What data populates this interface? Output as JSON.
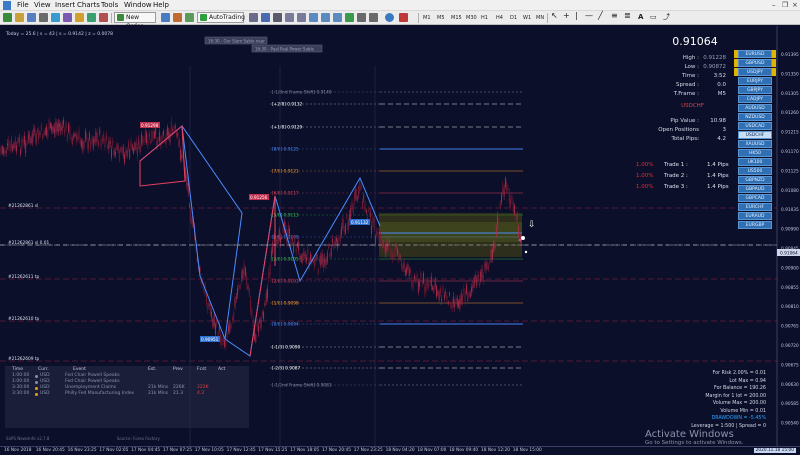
{
  "menu": {
    "items": [
      "File",
      "View",
      "Insert",
      "Charts",
      "Tools",
      "Window",
      "Help"
    ]
  },
  "toolbar": {
    "new_order": "New Order",
    "autotrading": "AutoTrading",
    "timeframes": [
      "M1",
      "M5",
      "M15",
      "M30",
      "H1",
      "H4",
      "D1",
      "W1",
      "MN"
    ]
  },
  "ohlc_line": "Today = 25.6 | s = 43 | s = 0.9142 | z = 0.0078",
  "chart_labels": {
    "top_box_1": "16:30 - Our Slam Sable near",
    "top_box_2": "16:30 - Paal Paal Power Sable",
    "levels": [
      {
        "label": "[-1/8nd Frame Shift] 0.9140",
        "color": "#8a8fa8"
      },
      {
        "label": "[+2/8] 0.9132",
        "color": "#ffffff"
      },
      {
        "label": "[+1/8] 0.9129",
        "color": "#ffffff"
      },
      {
        "label": "[8/8] 0.9125",
        "color": "#4a8cff"
      },
      {
        "label": "[7/8] 0.9121",
        "color": "#ff9a2a"
      },
      {
        "label": "[6/8] 0.9117",
        "color": "#e84060"
      },
      {
        "label": "[5/8] 0.9113",
        "color": "#36c84a"
      },
      {
        "label": "[4/8] 0.9109",
        "color": "#4a8cff"
      },
      {
        "label": "[3/8] 0.9105",
        "color": "#36c84a"
      },
      {
        "label": "[2/8] 0.9101",
        "color": "#e84060"
      },
      {
        "label": "[1/8] 0.9098",
        "color": "#ff9a2a"
      },
      {
        "label": "[0/8] 0.9094",
        "color": "#4a8cff"
      },
      {
        "label": "[-1/8] 0.9090",
        "color": "#ffffff"
      },
      {
        "label": "[-2/8] 0.9087",
        "color": "#ffffff"
      },
      {
        "label": "[-1/2nd Frame Shift] 0.9083",
        "color": "#8a8fa8"
      }
    ],
    "left_tags": [
      "#21262861 sl",
      "#21262861 sl 0.01",
      "#21262611 tp",
      "#21262610 tp",
      "#21262609 tp"
    ],
    "zz_high": "0.91298",
    "zz_mid": "0.91256",
    "zz_low": "0.90951",
    "zz_right": "0.91132"
  },
  "price_axis": [
    "0.91395",
    "0.91350",
    "0.91305",
    "0.91260",
    "0.91215",
    "0.91170",
    "0.91125",
    "0.91080",
    "0.91035",
    "0.90990",
    "0.90945",
    "0.90900",
    "0.90855",
    "0.90810",
    "0.90765",
    "0.90720",
    "0.90675",
    "0.90630",
    "0.90585",
    "0.90540"
  ],
  "price_axis_current": "0.91064",
  "info": {
    "price": "0.91064",
    "high_label": "High :",
    "high": "0.91228",
    "low_label": "Low :",
    "low": "0.90872",
    "time_label": "Time :",
    "time": "3:52",
    "spread_label": "Spread :",
    "spread": "0.0",
    "tf_label": "T.Frame :",
    "tf": "M5",
    "symbol": "USDCHF",
    "pipvalue_label": "Pip Value :",
    "pipvalue": "10.98",
    "openpos_label": "Open Positions :",
    "openpos": "3",
    "totalpips_label": "Total Pips:",
    "totalpips": "4.2"
  },
  "trades": [
    {
      "pct": "1.00%",
      "name": "Trade 1 :",
      "pips": "1.4 Pips"
    },
    {
      "pct": "1.00%",
      "name": "Trade 2 :",
      "pips": "1.4 Pips"
    },
    {
      "pct": "1.00%",
      "name": "Trade 3 :",
      "pips": "1.4 Pips"
    }
  ],
  "pairs": [
    "EURUSD",
    "GBPUSD",
    "USDJPY",
    "EURJPY",
    "GBPJPY",
    "CADJPY",
    "AUDUSD",
    "NZDUSD",
    "USDCAD",
    "USDCHF",
    "XAUUSD",
    "HK50",
    "UK100",
    "US500",
    "GBPNZD",
    "GBPAUD",
    "GBPCAD",
    "EURCHF",
    "EURAUD",
    "EURGBP"
  ],
  "pairs_selected": "USDCHF",
  "risk": [
    "For Risk 2.00% = 0.01",
    "Lot Max = 0.94",
    "For Balance = 190.26",
    "Margin for 1 lot = 200.00",
    "Volume Max = 200.00",
    "Volume Min = 0.01",
    "Leverage = 1:500 | Spread = 0"
  ],
  "drawdown": "DRAWDOWN = -5.45%",
  "news": {
    "headers": [
      "Time",
      "Curr.",
      "Event",
      "Est.",
      "Prev",
      "Fcst",
      "Act"
    ],
    "rows": [
      {
        "time": "1:00:00",
        "curr": "USD",
        "event": "Fed Chair Powell Speaks",
        "est": "",
        "prev": "",
        "fcst": "",
        "act": ""
      },
      {
        "time": "1:00:00",
        "curr": "USD",
        "event": "Fed Chair Powell Speaks",
        "est": "",
        "prev": "",
        "fcst": "",
        "act": ""
      },
      {
        "time": "3:30:00",
        "curr": "USD",
        "event": "Unemployment Claims",
        "est": "21k Mins",
        "prev": "226K",
        "fcst": "222K",
        "act": ""
      },
      {
        "time": "3:30:00",
        "curr": "USD",
        "event": "Philly Fed Manufacturing Index",
        "est": "21k Mins",
        "prev": "21.3",
        "fcst": "4.3",
        "act": ""
      }
    ]
  },
  "footer_left": "SaPS NewsInfo v2.7.8",
  "footer_right": "Source: Forex Factory",
  "time_axis": [
    "16 Nov 2018",
    "16 Nov 20:45",
    "16 Nov 23:25",
    "17 Nov 02:05",
    "17 Nov 04:45",
    "17 Nov 07:25",
    "17 Nov 10:05",
    "17 Nov 12:45",
    "17 Nov 15:25",
    "17 Nov 18:05",
    "17 Nov 20:45",
    "17 Nov 23:25",
    "18 Nov 04:20",
    "18 Nov 07:00",
    "18 Nov 09:40",
    "18 Nov 12:20",
    "18 Nov 15:00"
  ],
  "time_axis_badge": "2020.11.18 15:00",
  "watermark": {
    "title": "Activate Windows",
    "sub": "Go to Settings to activate Windows."
  },
  "colors": {
    "background": "#0b0f2a",
    "zigzag_up": "#4a8cff",
    "zigzag_down": "#e84060",
    "candles": "#c03050",
    "pair_button": "#2f6fb3",
    "drawdown": "#2fa4ff"
  }
}
